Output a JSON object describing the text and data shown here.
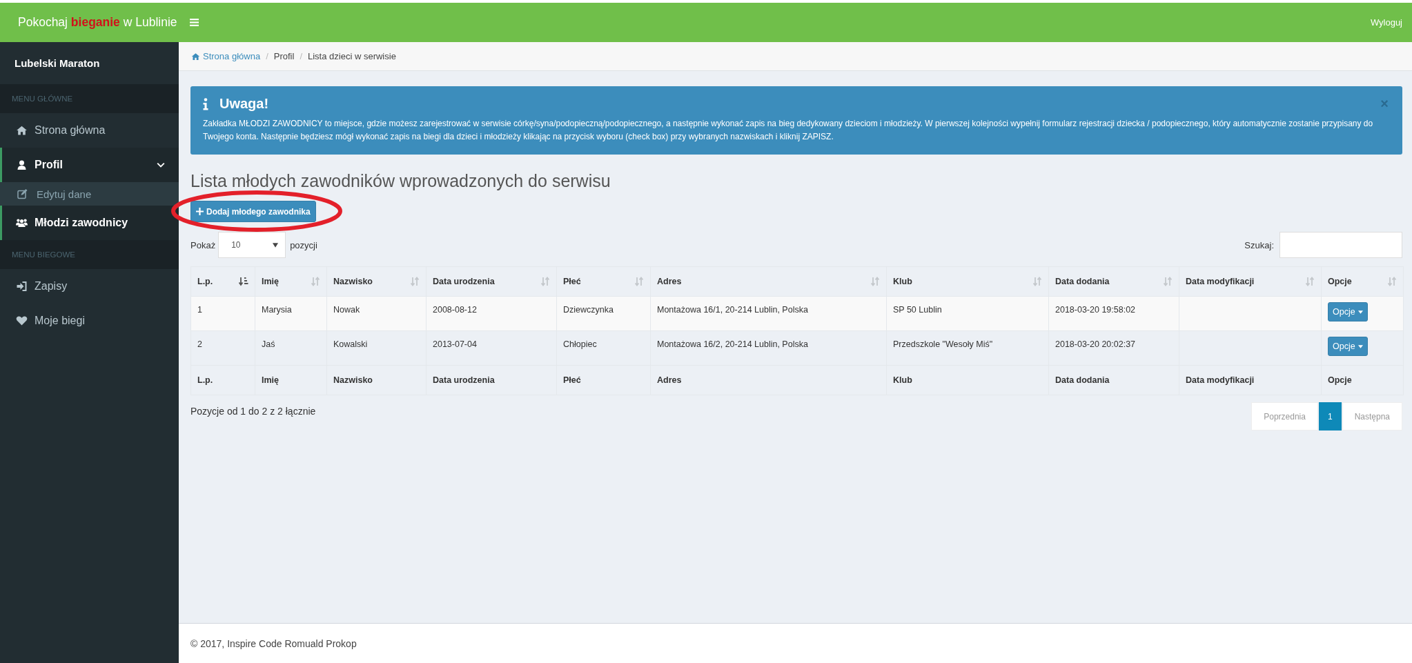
{
  "topbar": {
    "brand": [
      {
        "text": "Pokochaj ",
        "kind": "plain"
      },
      {
        "text": "bieganie",
        "kind": "accent"
      },
      {
        "text": " w Lublinie",
        "kind": "plain"
      }
    ],
    "logout": "Wyloguj"
  },
  "sidebar": {
    "title": "Lubelski Maraton",
    "sections": [
      {
        "label": "MENU GŁÓWNE",
        "items": [
          {
            "label": "Strona główna",
            "kind": "home",
            "selected": false
          },
          {
            "label": "Profil",
            "kind": "user",
            "selected": true,
            "expanded": true,
            "children": [
              {
                "label": "Edytuj dane",
                "kind": "edit",
                "selected": false
              }
            ]
          },
          {
            "label": "Młodzi zawodnicy",
            "kind": "users",
            "selected": true
          }
        ]
      },
      {
        "label": "MENU BIEGOWE",
        "items": [
          {
            "label": "Zapisy",
            "kind": "signin",
            "selected": false
          },
          {
            "label": "Moje biegi",
            "kind": "heart",
            "selected": false
          }
        ]
      }
    ]
  },
  "breadcrumb": [
    {
      "label": "Strona główna",
      "kind": "home"
    },
    {
      "separator": "/",
      "label": "Profil",
      "kind": "plain"
    },
    {
      "separator": "/",
      "label": "Lista dzieci w serwisie",
      "kind": "plain"
    }
  ],
  "alert": {
    "title": "Uwaga!",
    "text": "Zakładka MŁODZI ZAWODNICY to miejsce, gdzie możesz zarejestrować w serwisie córkę/syna/podopieczną/podopiecznego, a następnie wykonać zapis na bieg dedykowany dzieciom i młodzieży. W pierwszej kolejności wypełnij formularz rejestracji dziecka / podopiecznego, który automatycznie zostanie przypisany do Twojego konta. Następnie będziesz mógł wykonać zapis na biegi dla dzieci i młodzieży klikając na przycisk wyboru (check box) przy wybranych nazwiskach i kliknij ZAPISZ.",
    "close": "×"
  },
  "heading": "Lista młodych zawodników wprowadzonych do serwisu",
  "add_button": {
    "label": "Dodaj młodego zawodnika",
    "circled": true
  },
  "length": {
    "before": "Pokaż",
    "value": "10",
    "after": "pozycji"
  },
  "search": {
    "label": "Szukaj:"
  },
  "table": {
    "columns": [
      {
        "label": "L.p.",
        "sorted": true
      },
      {
        "label": "Imię",
        "sorted": false
      },
      {
        "label": "Nazwisko",
        "sorted": false
      },
      {
        "label": "Data urodzenia",
        "sorted": false
      },
      {
        "label": "Płeć",
        "sorted": false
      },
      {
        "label": "Adres",
        "sorted": false
      },
      {
        "label": "Klub",
        "sorted": false
      },
      {
        "label": "Data dodania",
        "sorted": false
      },
      {
        "label": "Data modyfikacji",
        "sorted": false
      },
      {
        "label": "Opcje",
        "sorted": false
      }
    ],
    "rows": [
      {
        "cells": [
          "1",
          "Marysia",
          "Nowak",
          "2008-08-12",
          "Dziewczynka",
          "Montażowa 16/1, 20-214 Lublin, Polska",
          "SP 50 Lublin",
          "2018-03-20 19:58:02",
          ""
        ],
        "action": "Opcje"
      },
      {
        "cells": [
          "2",
          "Jaś",
          "Kowalski",
          "2013-07-04",
          "Chłopiec",
          "Montażowa 16/2, 20-214 Lublin, Polska",
          "Przedszkole \"Wesoły Miś\"",
          "2018-03-20 20:02:37",
          ""
        ],
        "action": "Opcje"
      }
    ],
    "footer_columns": [
      "L.p.",
      "Imię",
      "Nazwisko",
      "Data urodzenia",
      "Płeć",
      "Adres",
      "Klub",
      "Data dodania",
      "Data modyfikacji",
      "Opcje"
    ]
  },
  "info": "Pozycje od 1 do 2 z 2 łącznie",
  "pagination": [
    {
      "label": "Poprzednia",
      "kind": "nav",
      "selected": false
    },
    {
      "label": "1",
      "kind": "page",
      "selected": true
    },
    {
      "label": "Następna",
      "kind": "nav",
      "selected": false
    }
  ],
  "footer": "© 2017, Inspire Code Romuald Prokop"
}
